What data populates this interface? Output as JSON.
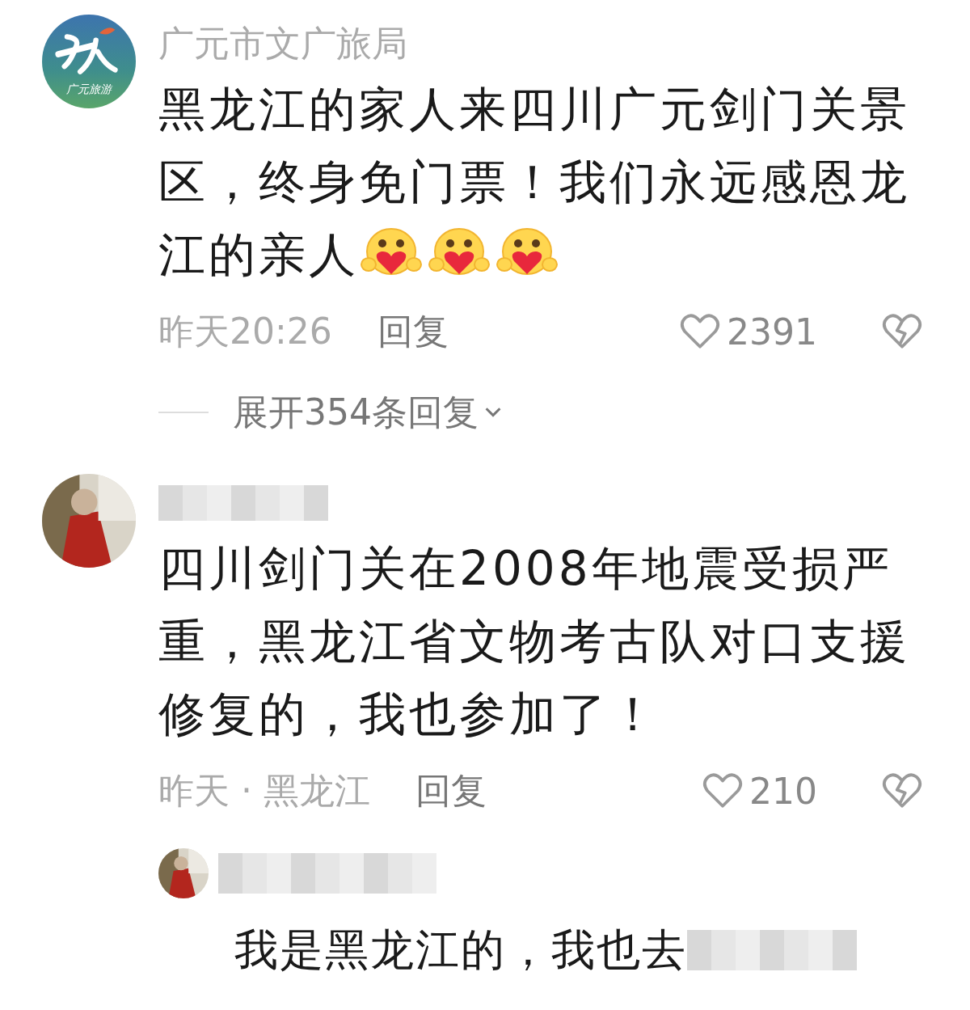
{
  "comments": [
    {
      "author": "广元市文广旅局",
      "name_blurred": false,
      "avatar": {
        "kind": "logo",
        "caption": "广元旅游"
      },
      "text": "黑龙江的家人来四川广元剑门关景区，终身免门票！我们永远感恩龙江的亲人",
      "emojis": [
        {
          "kind": "heart-hug"
        },
        {
          "kind": "heart-hug"
        },
        {
          "kind": "heart-hug"
        }
      ],
      "time": "昨天20:26",
      "reply_label": "回复",
      "likes": "2391",
      "liked": false,
      "expand": "展开354条回复"
    },
    {
      "name_blurred": true,
      "avatar": {
        "kind": "picture"
      },
      "text": "四川剑门关在2008年地震受损严重，黑龙江省文物考古队对口支援修复的，我也参加了！",
      "time": "昨天 · 黑龙江",
      "reply_label": "回复",
      "likes": "210",
      "liked": false,
      "replies": [
        {
          "name_blurred": true,
          "avatar": {
            "kind": "picture"
          },
          "text": "我是黑龙江的，我也去",
          "tail_blurred": true
        }
      ]
    }
  ]
}
